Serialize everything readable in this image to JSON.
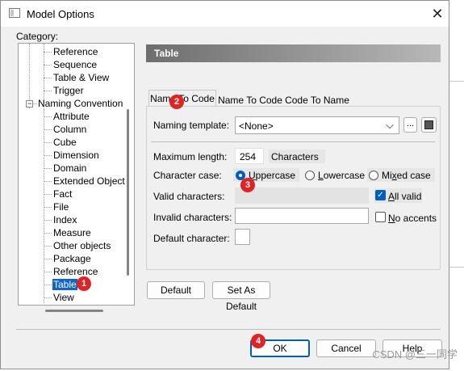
{
  "window": {
    "title": "Model Options",
    "close_glyph": "✕"
  },
  "category": {
    "label": "Category:",
    "items": [
      {
        "label": "Reference",
        "indent": 2
      },
      {
        "label": "Sequence",
        "indent": 2
      },
      {
        "label": "Table & View",
        "indent": 2
      },
      {
        "label": "Trigger",
        "indent": 2
      },
      {
        "label": "Naming Convention",
        "indent": 1,
        "expanded": true
      },
      {
        "label": "Attribute",
        "indent": 2
      },
      {
        "label": "Column",
        "indent": 2
      },
      {
        "label": "Cube",
        "indent": 2
      },
      {
        "label": "Dimension",
        "indent": 2
      },
      {
        "label": "Domain",
        "indent": 2
      },
      {
        "label": "Extended Object",
        "indent": 2
      },
      {
        "label": "Fact",
        "indent": 2
      },
      {
        "label": "File",
        "indent": 2
      },
      {
        "label": "Index",
        "indent": 2
      },
      {
        "label": "Measure",
        "indent": 2
      },
      {
        "label": "Other objects",
        "indent": 2
      },
      {
        "label": "Package",
        "indent": 2
      },
      {
        "label": "Reference",
        "indent": 2
      },
      {
        "label": "Table",
        "indent": 2,
        "selected": true
      },
      {
        "label": "View",
        "indent": 2
      }
    ],
    "collapse_glyph": "−"
  },
  "section": {
    "title": "Table"
  },
  "tabs": [
    {
      "label": "Name To Code",
      "active": true
    },
    {
      "label": "Name To Code",
      "active": false
    },
    {
      "label": "Code To Name",
      "active": false
    }
  ],
  "naming_template": {
    "label": "Naming template:",
    "value": "<None>",
    "dropdown_glyph": "⌵",
    "more_label": "..."
  },
  "max_length": {
    "label": "Maximum length:",
    "value": "254",
    "unit": "Characters"
  },
  "character_case": {
    "label": "Character case:",
    "options": [
      {
        "label": "Uppercase",
        "selected": true
      },
      {
        "label": "Lowercase",
        "selected": false
      },
      {
        "label": "Mixed case",
        "selected": false
      }
    ]
  },
  "valid_characters": {
    "label": "Valid characters:",
    "value": "",
    "all_valid_label": "All valid",
    "all_valid_checked": true,
    "check_glyph": "✓"
  },
  "invalid_characters": {
    "label": "Invalid characters:",
    "value": "",
    "no_accents_label": "No accents",
    "no_accents_checked": false
  },
  "default_character": {
    "label": "Default character:",
    "value": ""
  },
  "buttons": {
    "default": "Default",
    "set_as_default": "Set As Default",
    "ok": "OK",
    "cancel": "Cancel",
    "help": "Help"
  },
  "annotations": [
    "1",
    "2",
    "3",
    "4"
  ],
  "watermark": "CSDN @三一同学",
  "colors": {
    "accent": "#005fb8",
    "selection": "#0a64d4",
    "badge": "#e02424"
  }
}
